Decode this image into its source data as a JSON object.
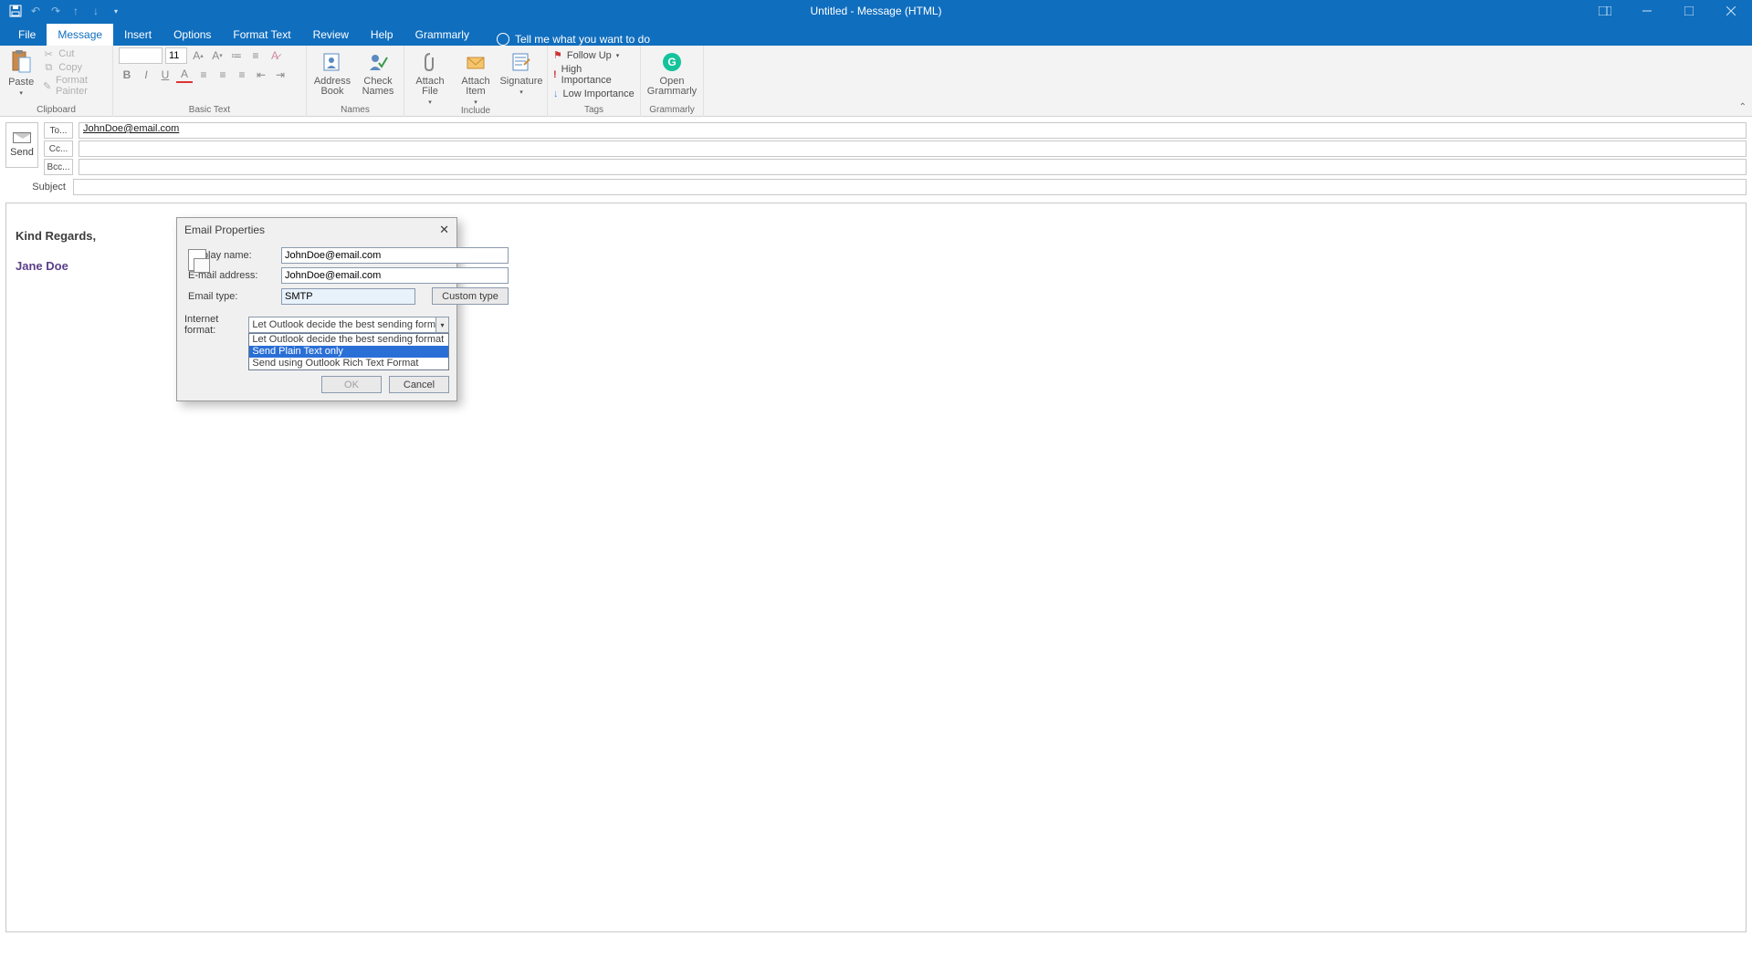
{
  "titlebar": {
    "title": "Untitled  -  Message (HTML)"
  },
  "tabs": {
    "file": "File",
    "message": "Message",
    "insert": "Insert",
    "options": "Options",
    "format_text": "Format Text",
    "review": "Review",
    "help": "Help",
    "grammarly": "Grammarly",
    "tell_me": "Tell me what you want to do"
  },
  "ribbon": {
    "clipboard": {
      "label": "Clipboard",
      "paste": "Paste",
      "cut": "Cut",
      "copy": "Copy",
      "format_painter": "Format Painter"
    },
    "basic_text": {
      "label": "Basic Text",
      "font_size": "11"
    },
    "names": {
      "label": "Names",
      "address_book": "Address Book",
      "check_names": "Check Names"
    },
    "include": {
      "label": "Include",
      "attach_file": "Attach File",
      "attach_item": "Attach Item",
      "signature": "Signature"
    },
    "tags": {
      "label": "Tags",
      "follow_up": "Follow Up",
      "high": "High Importance",
      "low": "Low Importance"
    },
    "grammarly_grp": {
      "label": "Grammarly",
      "open": "Open Grammarly"
    }
  },
  "addr": {
    "send": "Send",
    "to": "To...",
    "cc": "Cc...",
    "bcc": "Bcc...",
    "subject": "Subject",
    "to_value": "JohnDoe@email.com"
  },
  "body": {
    "regards": "Kind Regards,",
    "name": "Jane Doe"
  },
  "dialog": {
    "title": "Email Properties",
    "display_name_lbl": "Display name:",
    "display_name": "JohnDoe@email.com",
    "email_lbl": "E-mail address:",
    "email": "JohnDoe@email.com",
    "type_lbl": "Email type:",
    "type": "SMTP",
    "custom_type": "Custom type",
    "format_lbl": "Internet format:",
    "format_sel": "Let Outlook decide the best sending form",
    "opt1": "Let Outlook decide the best sending format",
    "opt2": "Send Plain Text only",
    "opt3": "Send using Outlook Rich Text Format",
    "ok": "OK",
    "cancel": "Cancel"
  }
}
